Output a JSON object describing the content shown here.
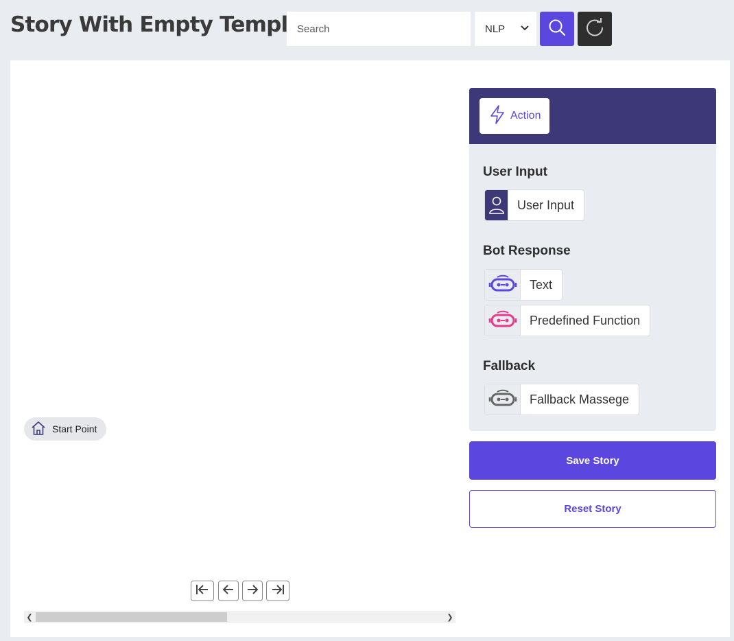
{
  "header": {
    "title": "Story With Empty Template",
    "search_placeholder": "Search",
    "search_value": "",
    "mode_select": {
      "selected": "NLP"
    }
  },
  "canvas": {
    "start_node_label": "Start Point",
    "pager_icons": [
      "first-page-icon",
      "prev-page-icon",
      "next-page-icon",
      "last-page-icon"
    ]
  },
  "sidebar": {
    "tab_label": "Action",
    "sections": {
      "user_input": {
        "title": "User Input",
        "items": [
          {
            "label": "User Input",
            "icon": "user-icon"
          }
        ]
      },
      "bot_response": {
        "title": "Bot Response",
        "items": [
          {
            "label": "Text",
            "icon": "bot-icon",
            "color": "#5b46e0"
          },
          {
            "label": "Predefined Function",
            "icon": "bot-icon",
            "color": "#e8388a"
          }
        ]
      },
      "fallback": {
        "title": "Fallback",
        "items": [
          {
            "label": "Fallback Massege",
            "icon": "bot-icon",
            "color": "#666666"
          }
        ]
      }
    }
  },
  "actions": {
    "save_label": "Save Story",
    "reset_label": "Reset Story"
  },
  "colors": {
    "accent": "#5b46e0",
    "header_dark": "#3d3878",
    "background": "#e9ecf1"
  }
}
